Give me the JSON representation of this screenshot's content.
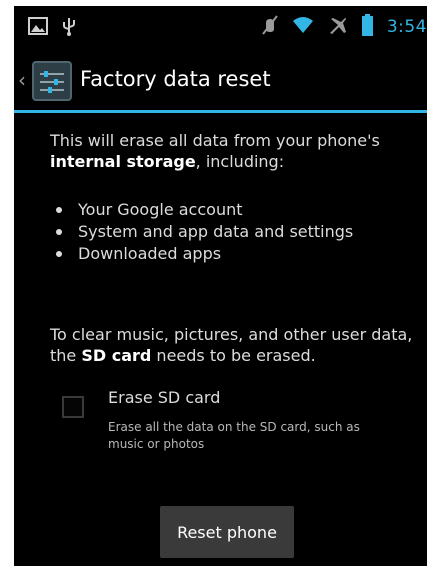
{
  "status_bar": {
    "left_icons": [
      "image-icon",
      "usb-icon"
    ],
    "right_icons": [
      "mute-icon",
      "wifi-icon",
      "airplane-icon",
      "battery-icon"
    ],
    "time": "3:54"
  },
  "action_bar": {
    "title": "Factory data reset",
    "up_caret": "‹",
    "icon": "settings-icon"
  },
  "content": {
    "intro_prefix": "This will erase all data from your phone's ",
    "intro_bold": "internal storage",
    "intro_suffix": ", including:",
    "bullets": [
      "Your Google account",
      "System and app data and settings",
      "Downloaded apps"
    ],
    "sd_prefix": "To clear music, pictures, and other user data, the ",
    "sd_bold": "SD card",
    "sd_suffix": " needs to be erased."
  },
  "erase_sd": {
    "title": "Erase SD card",
    "summary": "Erase all the data on the SD card, such as music or photos",
    "checked": false
  },
  "reset_button": {
    "label": "Reset phone"
  },
  "colors": {
    "accent": "#33b5e5",
    "background": "#000000",
    "button": "#3a3a3a"
  }
}
